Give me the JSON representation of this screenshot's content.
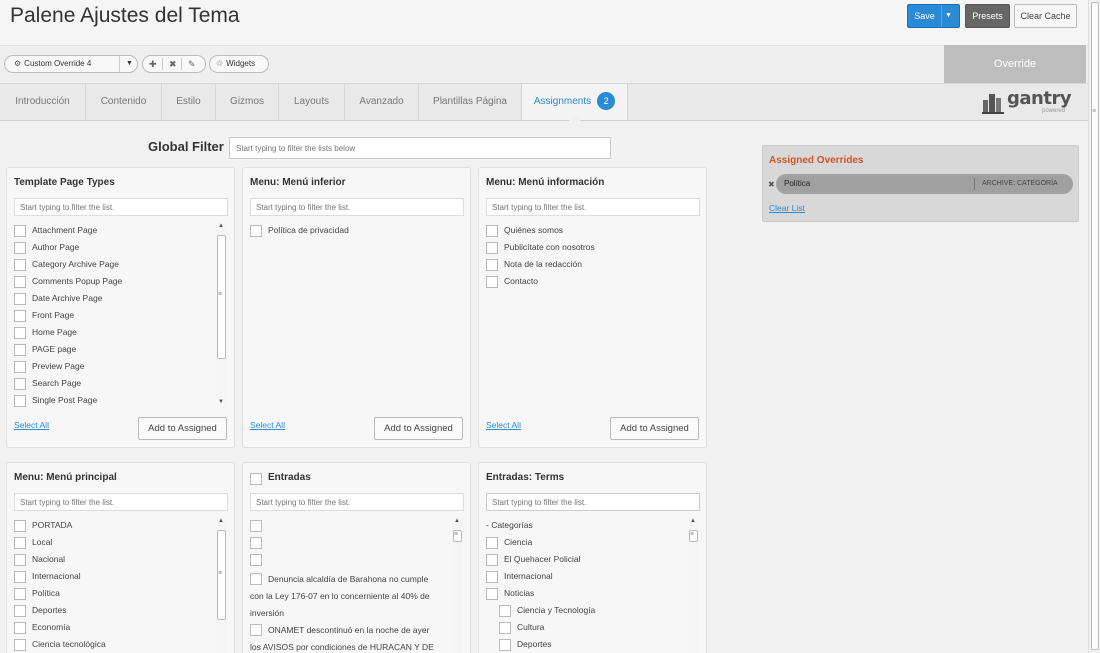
{
  "header": {
    "title": "Palene Ajustes del Tema",
    "save_label": "Save",
    "presets_label": "Presets",
    "clear_cache_label": "Clear Cache"
  },
  "toolbar": {
    "override_select": "Custom Override 4",
    "widgets_label": "Widgets",
    "override_tab": "Override"
  },
  "tabs": [
    {
      "label": "Introducción"
    },
    {
      "label": "Contenido"
    },
    {
      "label": "Estilo"
    },
    {
      "label": "Gizmos"
    },
    {
      "label": "Layouts"
    },
    {
      "label": "Avanzado"
    },
    {
      "label": "Plantillas Página"
    },
    {
      "label": "Assignments",
      "badge": "2",
      "active": true
    }
  ],
  "logo": {
    "text": "gantry",
    "sub": "powered"
  },
  "global_filter": {
    "label": "Global Filter",
    "placeholder": "Start typing to filter the lists below"
  },
  "panel_common": {
    "filter_placeholder": "Start typing to filter the list.",
    "select_all": "Select All",
    "add_to_assigned": "Add to Assigned"
  },
  "panels": {
    "template_page_types": {
      "title": "Template Page Types",
      "items": [
        "Attachment Page",
        "Author Page",
        "Category Archive Page",
        "Comments Popup Page",
        "Date Archive Page",
        "Front Page",
        "Home Page",
        "PAGE page",
        "Preview Page",
        "Search Page",
        "Single Post Page"
      ]
    },
    "menu_inferior": {
      "title": "Menu: Menú inferior",
      "items": [
        "Política de privacidad"
      ]
    },
    "menu_informacion": {
      "title": "Menu: Menú información",
      "items": [
        "Quiénes somos",
        "Publicítate con nosotros",
        "Nota de la redacción",
        "Contacto"
      ]
    },
    "menu_principal": {
      "title": "Menu: Menú principal",
      "items": [
        "PORTADA",
        "Local",
        "Nacional",
        "Internacional",
        "Política",
        "Deportes",
        "Economía",
        "Ciencia tecnológica"
      ]
    },
    "entradas": {
      "title": "Entradas",
      "post1": [
        "Denuncia alcaldía de Barahona no cumple",
        "con  la Ley 176-07 en lo concerniente al 40% de",
        "inversión"
      ],
      "post2": [
        "ONAMET descontinuó en la noche de ayer",
        "los AVISOS por condiciones de HURACAN  Y DE"
      ]
    },
    "entradas_terms": {
      "title": "Entradas: Terms",
      "filter_placeholder": "Start typing to filter the list.",
      "group": "- Categorías",
      "items": [
        "Ciencia",
        "El Quehacer Policial",
        "Internacional",
        "Noticias"
      ],
      "sub_items": [
        "Ciencia y Tecnología",
        "Cultura",
        "Deportes"
      ]
    }
  },
  "assigned": {
    "title": "Assigned Overrides",
    "item_name": "Política",
    "item_type": "ARCHIVE: CATEGORÍA",
    "clear_list": "Clear List"
  },
  "colors": {
    "accent": "#2a8ad3",
    "assigned_title": "#d1542b",
    "presets_bg": "#666666"
  }
}
